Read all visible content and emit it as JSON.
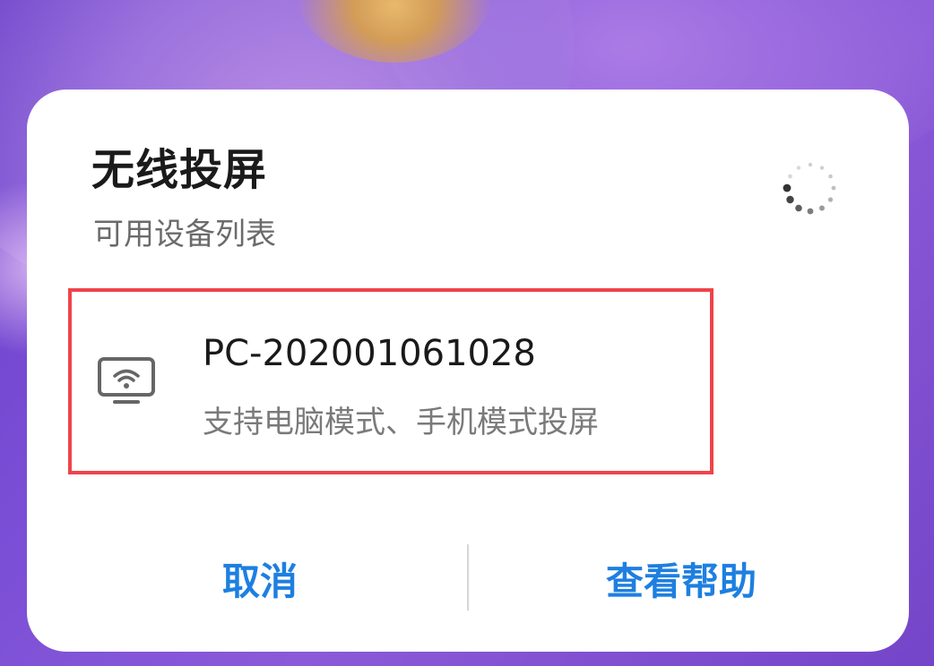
{
  "dialog": {
    "title": "无线投屏",
    "subtitle": "可用设备列表",
    "loading_icon": "spinner-icon"
  },
  "devices": [
    {
      "name": "PC-202001061028",
      "description": "支持电脑模式、手机模式投屏",
      "icon": "wireless-display-icon",
      "highlight_color": "#f0434a"
    }
  ],
  "buttons": {
    "cancel_label": "取消",
    "help_label": "查看帮助"
  },
  "colors": {
    "accent": "#1e7fe0",
    "highlight": "#f0434a"
  }
}
